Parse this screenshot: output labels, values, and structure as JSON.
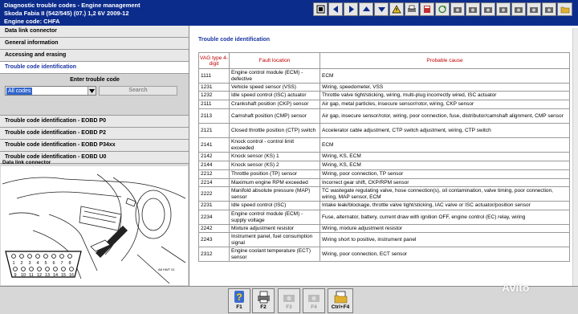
{
  "window": {
    "title": "Diagnostic trouble codes - Engine management",
    "vehicle": "Skoda   Fabia II (542/545) (07.) 1,2 6V 2009-12",
    "engine": "Engine code: CHFA"
  },
  "nav_icons": [
    "home-icon",
    "back-icon",
    "forward-icon",
    "up-icon",
    "down-icon",
    "warning-icon",
    "print-icon",
    "book-icon",
    "refresh-icon",
    "camera-icon",
    "camera-icon",
    "camera-icon",
    "camera-icon",
    "camera-icon",
    "camera-icon",
    "camera-icon",
    "folder-icon"
  ],
  "menu": {
    "items_top": [
      {
        "label": "Data link connector"
      },
      {
        "label": "General information"
      },
      {
        "label": "Accessing and erasing"
      },
      {
        "label": "Trouble code identification"
      }
    ],
    "enter_label": "Enter trouble code",
    "combo_value": "All codes",
    "search_label": "Search",
    "items_bottom": [
      {
        "label": "Trouble code identification - EOBD P0"
      },
      {
        "label": "Trouble code identification - EOBD P2"
      },
      {
        "label": "Trouble code identification - EOBD P34xx"
      },
      {
        "label": "Trouble code identification - EOBD U0"
      }
    ],
    "dlc_label": "Data link connector",
    "pins_top": [
      "1",
      "2",
      "3",
      "4",
      "5",
      "6",
      "7",
      "8"
    ],
    "pins_bottom": [
      "9",
      "10",
      "11",
      "12",
      "13",
      "14",
      "15",
      "16"
    ],
    "image_code": "A8 HWT 01"
  },
  "main": {
    "heading": "Trouble code identification",
    "columns": [
      "VAG type 4-digit",
      "Fault location",
      "Probable cause"
    ],
    "rows": [
      {
        "code": "1111",
        "location": "Engine control module (ECM) - defective",
        "cause": "ECM"
      },
      {
        "code": "1231",
        "location": "Vehicle speed sensor (VSS)",
        "cause": "Wiring, speedometer, VSS"
      },
      {
        "code": "1232",
        "location": "Idle speed control (ISC) actuator",
        "cause": "Throttle valve tight/sticking, wiring, multi-plug incorrectly wired, ISC actuator"
      },
      {
        "code": "2111",
        "location": "Crankshaft position (CKP) sensor",
        "cause": "Air gap, metal particles, insecure sensor/rotor, wiring, CKP sensor"
      },
      {
        "code": "2113",
        "location": "Camshaft position (CMP) sensor",
        "cause": "Air gap, insecure sensor/rotor, wiring, poor connection, fuse, distributor/camshaft alignment, CMP sensor"
      },
      {
        "code": "2121",
        "location": "Closed throttle position (CTP) switch",
        "cause": "Accelerator cable adjustment, CTP switch adjustment, wiring, CTP switch"
      },
      {
        "code": "2141",
        "location": "Knock control - control limit exceeded",
        "cause": "ECM"
      },
      {
        "code": "2142",
        "location": "Knock sensor (KS) 1",
        "cause": "Wiring, KS, ECM"
      },
      {
        "code": "2144",
        "location": "Knock sensor (KS) 2",
        "cause": "Wiring, KS, ECM"
      },
      {
        "code": "2212",
        "location": "Throttle position (TP) sensor",
        "cause": "Wiring, poor connection, TP sensor"
      },
      {
        "code": "2214",
        "location": "Maximum engine RPM exceeded",
        "cause": "Incorrect gear shift, CKP/RPM sensor"
      },
      {
        "code": "2222",
        "location": "Manifold absolute pressure (MAP) sensor",
        "cause": "TC wastegate regulating valve, hose connection(s), oil contamination, valve timing, poor connection, wiring, MAP sensor, ECM"
      },
      {
        "code": "2231",
        "location": "Idle speed control (ISC)",
        "cause": "Intake leak/blockage, throttle valve tight/sticking, IAC valve or ISC actuator/position sensor"
      },
      {
        "code": "2234",
        "location": "Engine control module (ECM) - supply voltage",
        "cause": "Fuse, alternator, battery, current draw with ignition OFF, engine control (EC) relay, wiring"
      },
      {
        "code": "2242",
        "location": "Mixture adjustment resistor",
        "cause": "Wiring, mixture adjustment resistor"
      },
      {
        "code": "2243",
        "location": "Instrument panel, fuel consumption signal",
        "cause": "Wiring short to positive, instrument panel"
      },
      {
        "code": "2312",
        "location": "Engine coolant temperature (ECT) sensor",
        "cause": "Wiring, poor connection, ECT sensor"
      }
    ]
  },
  "toolbar": {
    "keys": [
      {
        "label": "F1",
        "icon": "help-icon",
        "enabled": true
      },
      {
        "label": "F2",
        "icon": "print-icon",
        "enabled": true
      },
      {
        "label": "F3",
        "icon": "camera-icon",
        "enabled": false
      },
      {
        "label": "F4",
        "icon": "camera-icon",
        "enabled": false
      },
      {
        "label": "Ctrl+F4",
        "icon": "folder-icon",
        "enabled": true
      }
    ]
  },
  "watermark": "Avito"
}
